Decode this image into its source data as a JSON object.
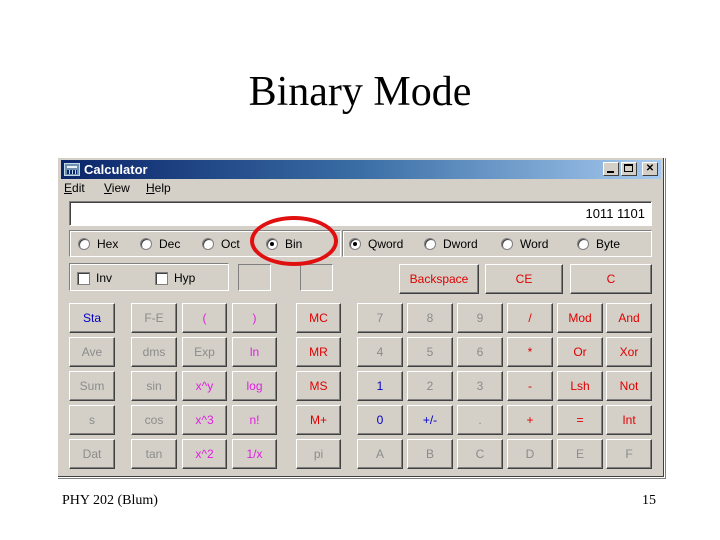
{
  "slide": {
    "title": "Binary Mode",
    "footer_left": "PHY 202 (Blum)",
    "page_number": "15"
  },
  "window": {
    "title": "Calculator",
    "icons": {
      "app": "calculator-icon",
      "minimize": "minimize-icon",
      "maximize": "maximize-icon",
      "close": "close-icon"
    },
    "close_glyph": "✕"
  },
  "menu": [
    {
      "accel": "E",
      "rest": "dit"
    },
    {
      "accel": "V",
      "rest": "iew"
    },
    {
      "accel": "H",
      "rest": "elp"
    }
  ],
  "display": {
    "value": "1011 1101"
  },
  "base_radios": [
    {
      "label": "Hex",
      "selected": false
    },
    {
      "label": "Dec",
      "selected": false
    },
    {
      "label": "Oct",
      "selected": false
    },
    {
      "label": "Bin",
      "selected": true
    }
  ],
  "word_radios": [
    {
      "label": "Qword",
      "selected": true
    },
    {
      "label": "Dword",
      "selected": false
    },
    {
      "label": "Word",
      "selected": false
    },
    {
      "label": "Byte",
      "selected": false
    }
  ],
  "checkboxes": [
    {
      "label": "Inv",
      "checked": false
    },
    {
      "label": "Hyp",
      "checked": false
    }
  ],
  "edit_buttons": [
    "Backspace",
    "CE",
    "C"
  ],
  "keypad": [
    [
      "Sta",
      "F-E",
      "(",
      ")",
      "MC",
      "7",
      "8",
      "9",
      "/",
      "Mod",
      "And"
    ],
    [
      "Ave",
      "dms",
      "Exp",
      "ln",
      "MR",
      "4",
      "5",
      "6",
      "*",
      "Or",
      "Xor"
    ],
    [
      "Sum",
      "sin",
      "x^y",
      "log",
      "MS",
      "1",
      "2",
      "3",
      "-",
      "Lsh",
      "Not"
    ],
    [
      "s",
      "cos",
      "x^3",
      "n!",
      "M+",
      "0",
      "+/-",
      ".",
      "+",
      "=",
      "Int"
    ],
    [
      "Dat",
      "tan",
      "x^2",
      "1/x",
      "pi",
      "A",
      "B",
      "C",
      "D",
      "E",
      "F"
    ]
  ],
  "keypad_colors": [
    [
      "blue",
      "gray",
      "mag",
      "mag",
      "red",
      "gray",
      "gray",
      "gray",
      "red",
      "red",
      "red"
    ],
    [
      "gray",
      "gray",
      "gray",
      "mag",
      "red",
      "gray",
      "gray",
      "gray",
      "red",
      "red",
      "red"
    ],
    [
      "gray",
      "gray",
      "mag",
      "mag",
      "red",
      "blue",
      "gray",
      "gray",
      "red",
      "red",
      "red"
    ],
    [
      "gray",
      "gray",
      "mag",
      "mag",
      "red",
      "blue",
      "blue",
      "gray",
      "red",
      "red",
      "red"
    ],
    [
      "gray",
      "gray",
      "mag",
      "mag",
      "gray",
      "gray",
      "gray",
      "gray",
      "gray",
      "gray",
      "gray"
    ]
  ],
  "annotation": {
    "highlighted": "Bin",
    "color": "#e01010"
  }
}
